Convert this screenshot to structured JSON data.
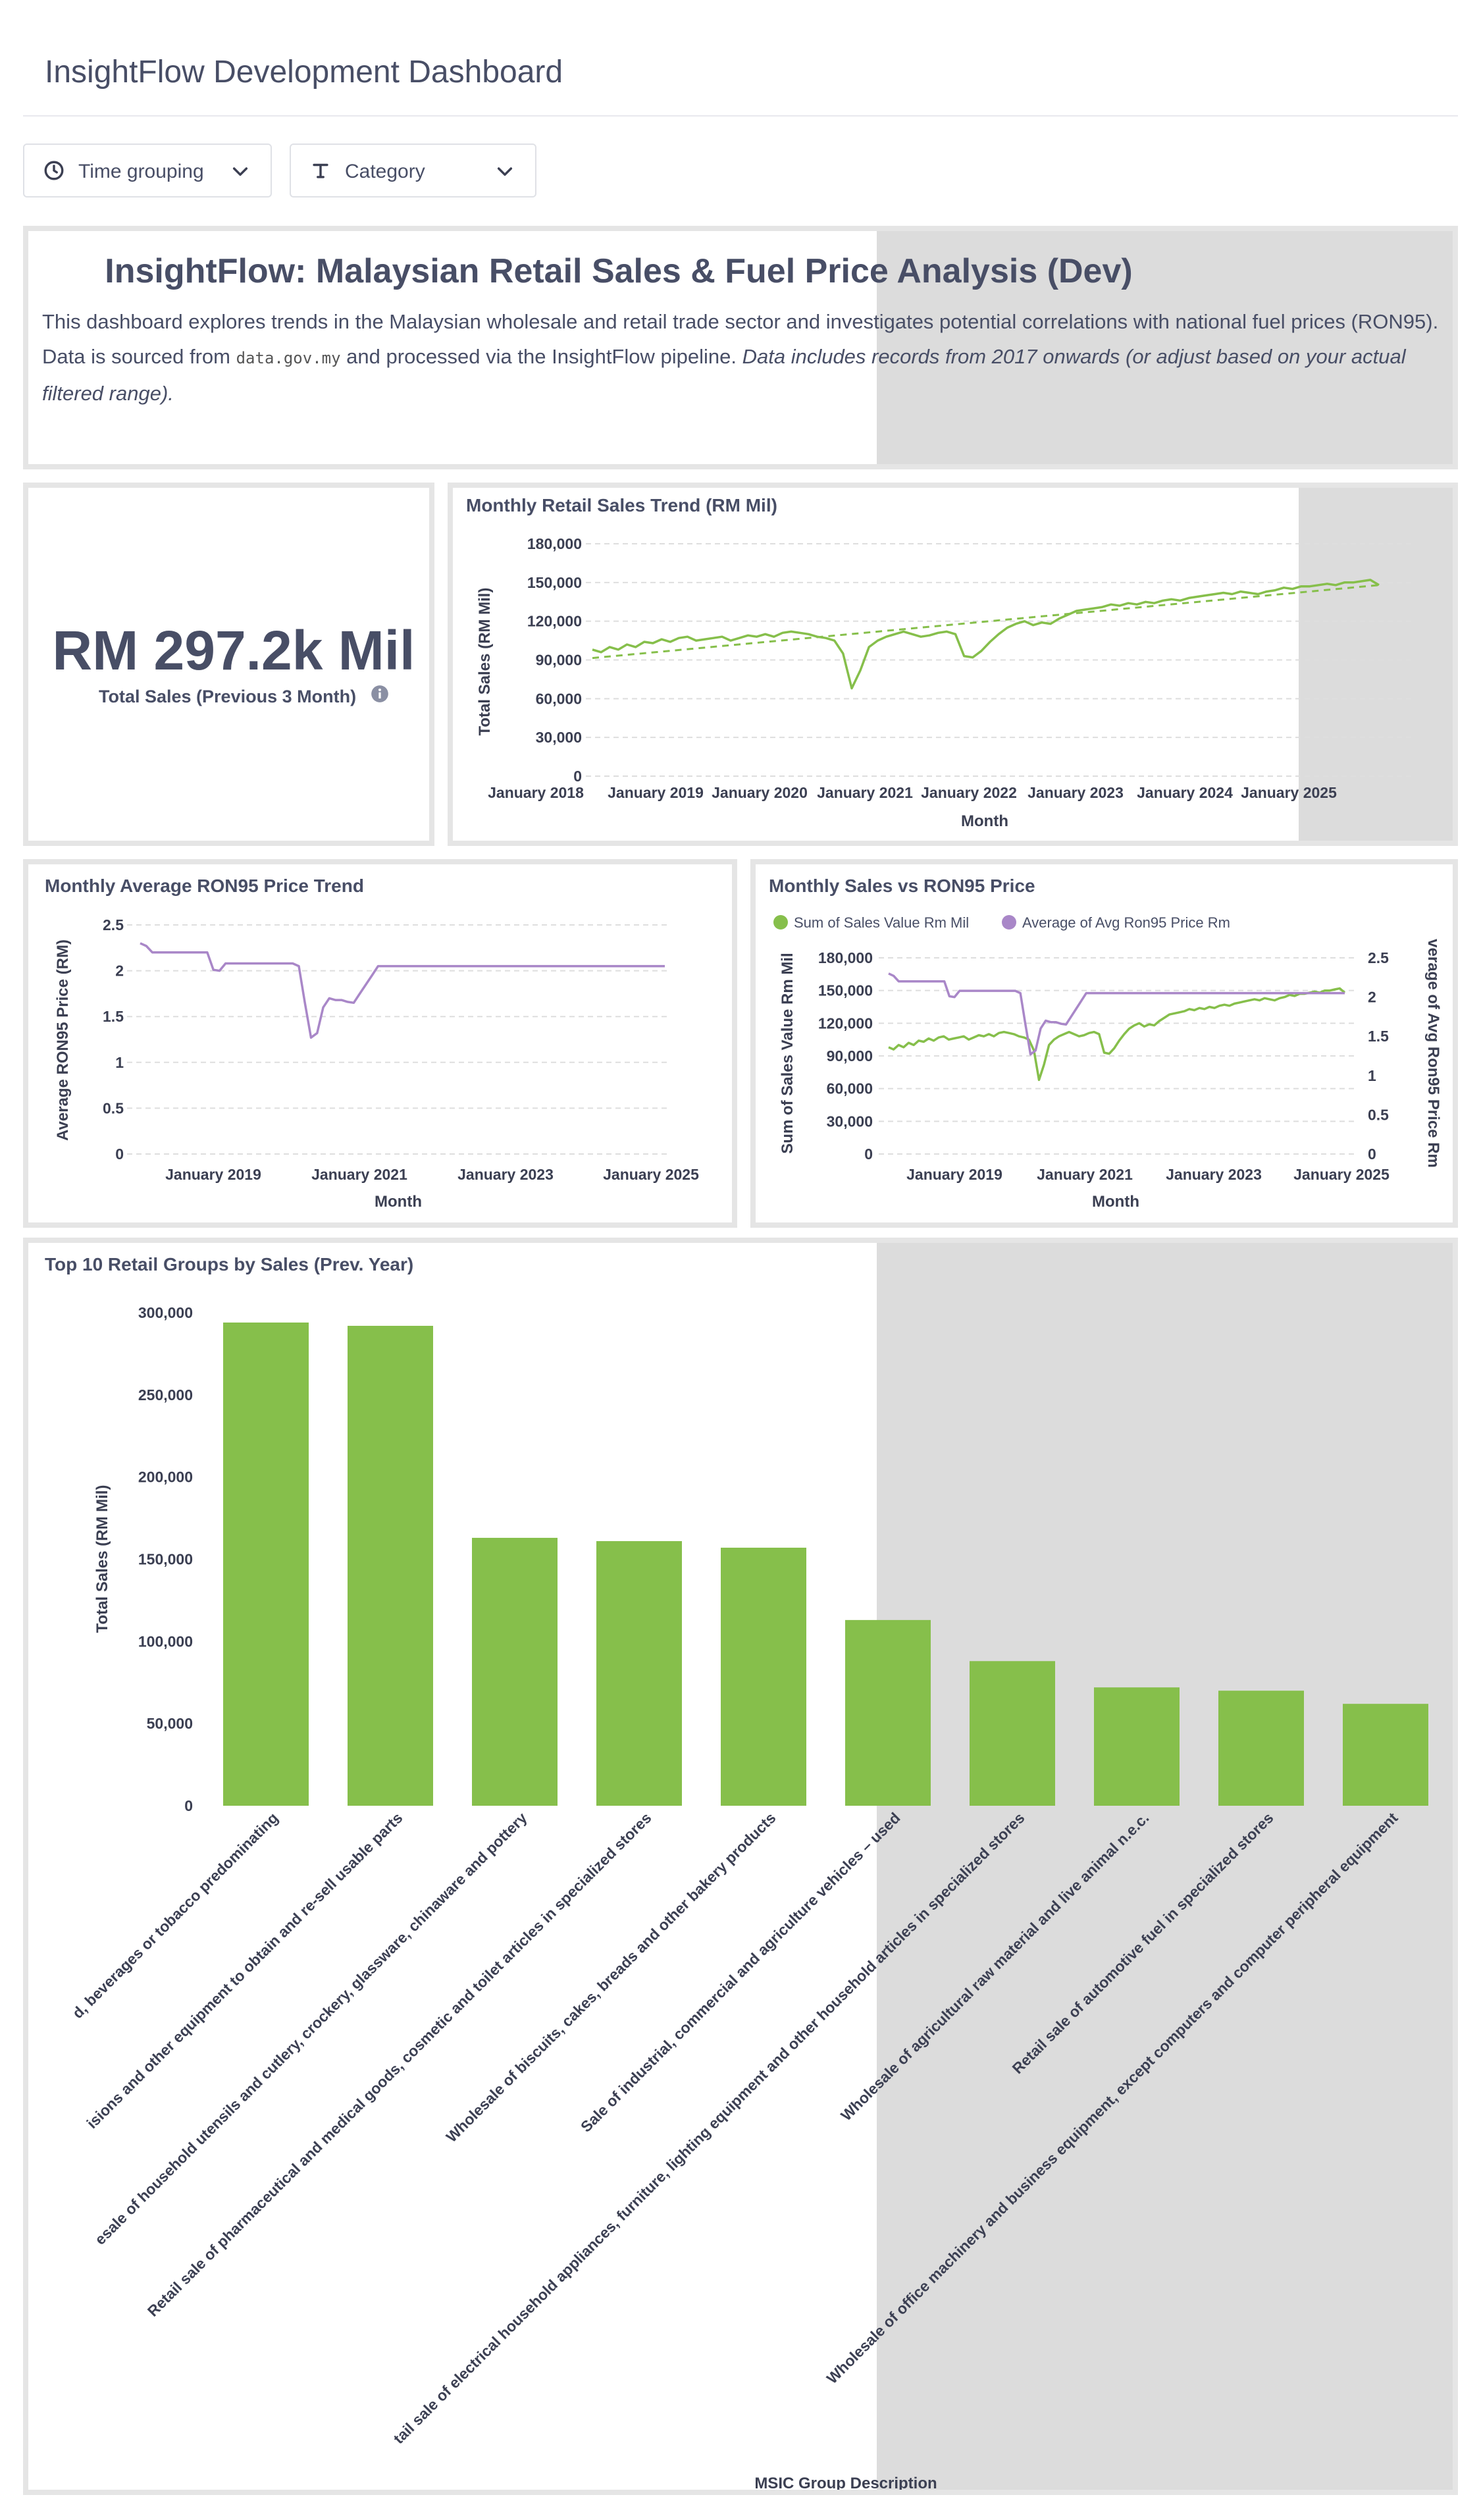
{
  "header": {
    "title": "InsightFlow Development Dashboard"
  },
  "filters": [
    {
      "label": "Time grouping",
      "icon": "clock-icon"
    },
    {
      "label": "Category",
      "icon": "text-type-icon"
    }
  ],
  "intro": {
    "heading": "InsightFlow: Malaysian Retail Sales & Fuel Price Analysis (Dev)",
    "body_1": "This dashboard explores trends in the Malaysian wholesale and retail trade sector and investigates potential correlations with national fuel prices (RON95). Data is sourced from ",
    "code": "data.gov.my",
    "body_2": " and processed via the InsightFlow pipeline. ",
    "body_italic": "Data includes records from 2017 onwards (or adjust based on your actual filtered range)."
  },
  "kpi": {
    "value": "RM 297.2k Mil",
    "label": "Total Sales (Previous 3 Month)",
    "icon": "info-icon"
  },
  "colors": {
    "green": "#86bf4b",
    "purple": "#a987c8",
    "shade": "#dcdcdc",
    "text": "#484e66"
  },
  "chart_data": [
    {
      "type": "line",
      "title": "Monthly Retail Sales Trend (RM Mil)",
      "xlabel": "Month",
      "ylabel": "Total Sales (RM Mil)",
      "ylim": [
        0,
        180000
      ],
      "yticks": [
        "0",
        "30,000",
        "60,000",
        "90,000",
        "120,000",
        "150,000",
        "180,000"
      ],
      "xticks": [
        "January 2018",
        "January 2019",
        "January 2020",
        "January 2021",
        "January 2022",
        "January 2023",
        "January 2024",
        "January 2025"
      ],
      "trendline": true,
      "series": [
        {
          "values": [
            98000,
            96000,
            100000,
            98000,
            102000,
            100000,
            104000,
            103000,
            106000,
            104000,
            107000,
            108000,
            105000,
            106000,
            107000,
            108000,
            105000,
            107000,
            109000,
            108000,
            110000,
            108000,
            111000,
            112000,
            111000,
            110000,
            108000,
            107000,
            105000,
            95000,
            68000,
            82000,
            100000,
            105000,
            108000,
            110000,
            112000,
            110000,
            108000,
            109000,
            111000,
            112000,
            110000,
            93000,
            92000,
            97000,
            104000,
            110000,
            115000,
            118000,
            120000,
            117000,
            119000,
            118000,
            122000,
            125000,
            128000,
            129000,
            130000,
            131000,
            133000,
            132000,
            134000,
            133000,
            135000,
            134000,
            136000,
            137000,
            136000,
            138000,
            139000,
            140000,
            141000,
            142000,
            141000,
            143000,
            142000,
            141000,
            143000,
            144000,
            146000,
            145000,
            147000,
            147000,
            148000,
            149000,
            148000,
            150000,
            150000,
            151000,
            152000,
            148000
          ]
        }
      ]
    },
    {
      "type": "line",
      "title": "Monthly Average RON95 Price Trend",
      "xlabel": "Month",
      "ylabel": "Average RON95 Price (RM)",
      "ylim": [
        0,
        2.5
      ],
      "yticks": [
        "0",
        "0.5",
        "1",
        "1.5",
        "2",
        "2.5"
      ],
      "xticks": [
        "January 2019",
        "January 2021",
        "January 2023",
        "January 2025"
      ],
      "series": [
        {
          "values": [
            2.3,
            2.27,
            2.2,
            2.2,
            2.2,
            2.2,
            2.2,
            2.2,
            2.2,
            2.2,
            2.2,
            2.2,
            2.01,
            2.0,
            2.08,
            2.08,
            2.08,
            2.08,
            2.08,
            2.08,
            2.08,
            2.08,
            2.08,
            2.08,
            2.08,
            2.08,
            2.05,
            1.65,
            1.27,
            1.32,
            1.6,
            1.7,
            1.68,
            1.68,
            1.66,
            1.65,
            1.75,
            1.85,
            1.95,
            2.05,
            2.05,
            2.05,
            2.05,
            2.05,
            2.05,
            2.05,
            2.05,
            2.05,
            2.05,
            2.05,
            2.05,
            2.05,
            2.05,
            2.05,
            2.05,
            2.05,
            2.05,
            2.05,
            2.05,
            2.05,
            2.05,
            2.05,
            2.05,
            2.05,
            2.05,
            2.05,
            2.05,
            2.05,
            2.05,
            2.05,
            2.05,
            2.05,
            2.05,
            2.05,
            2.05,
            2.05,
            2.05,
            2.05,
            2.05,
            2.05,
            2.05,
            2.05,
            2.05,
            2.05,
            2.05,
            2.05,
            2.05
          ]
        }
      ]
    },
    {
      "type": "line",
      "title": "Monthly Sales vs RON95 Price",
      "xlabel": "Month",
      "ylabel": "Sum of Sales Value Rm Mil",
      "y2label": "verage of Avg Ron95 Price Rm",
      "ylim": [
        0,
        180000
      ],
      "y2lim": [
        0,
        2.5
      ],
      "yticks": [
        "0",
        "30,000",
        "60,000",
        "90,000",
        "120,000",
        "150,000",
        "180,000"
      ],
      "y2ticks": [
        "0",
        "0.5",
        "1",
        "1.5",
        "2",
        "2.5"
      ],
      "xticks": [
        "January 2019",
        "January 2021",
        "January 2023",
        "January 2025"
      ],
      "legend": "top-left",
      "series": [
        {
          "name": "Sum of Sales Value Rm Mil",
          "axis": "left",
          "values": [
            98000,
            96000,
            100000,
            98000,
            102000,
            100000,
            104000,
            103000,
            106000,
            104000,
            107000,
            108000,
            105000,
            106000,
            107000,
            108000,
            105000,
            107000,
            109000,
            108000,
            110000,
            108000,
            111000,
            112000,
            111000,
            110000,
            108000,
            107000,
            105000,
            95000,
            68000,
            82000,
            100000,
            105000,
            108000,
            110000,
            112000,
            110000,
            108000,
            109000,
            111000,
            112000,
            110000,
            93000,
            92000,
            97000,
            104000,
            110000,
            115000,
            118000,
            120000,
            117000,
            119000,
            118000,
            122000,
            125000,
            128000,
            129000,
            130000,
            131000,
            133000,
            132000,
            134000,
            133000,
            135000,
            134000,
            136000,
            137000,
            136000,
            138000,
            139000,
            140000,
            141000,
            142000,
            141000,
            143000,
            142000,
            141000,
            143000,
            144000,
            146000,
            145000,
            147000,
            147000,
            148000,
            149000,
            148000,
            150000,
            150000,
            151000,
            152000,
            148000
          ]
        },
        {
          "name": "Average of Avg Ron95 Price Rm",
          "axis": "right",
          "values": [
            2.3,
            2.27,
            2.2,
            2.2,
            2.2,
            2.2,
            2.2,
            2.2,
            2.2,
            2.2,
            2.2,
            2.2,
            2.01,
            2.0,
            2.08,
            2.08,
            2.08,
            2.08,
            2.08,
            2.08,
            2.08,
            2.08,
            2.08,
            2.08,
            2.08,
            2.08,
            2.05,
            1.65,
            1.27,
            1.32,
            1.6,
            1.7,
            1.68,
            1.68,
            1.66,
            1.65,
            1.75,
            1.85,
            1.95,
            2.05,
            2.05,
            2.05,
            2.05,
            2.05,
            2.05,
            2.05,
            2.05,
            2.05,
            2.05,
            2.05,
            2.05,
            2.05,
            2.05,
            2.05,
            2.05,
            2.05,
            2.05,
            2.05,
            2.05,
            2.05,
            2.05,
            2.05,
            2.05,
            2.05,
            2.05,
            2.05,
            2.05,
            2.05,
            2.05,
            2.05,
            2.05,
            2.05,
            2.05,
            2.05,
            2.05,
            2.05,
            2.05,
            2.05,
            2.05,
            2.05,
            2.05,
            2.05,
            2.05,
            2.05,
            2.05,
            2.05,
            2.05,
            2.05,
            2.05,
            2.05,
            2.05
          ]
        }
      ]
    },
    {
      "type": "bar",
      "title": "Top 10 Retail Groups by Sales (Prev. Year)",
      "xlabel": "MSIC  Group Description",
      "ylabel": "Total Sales (RM Mil)",
      "ylim": [
        0,
        300000
      ],
      "yticks": [
        "0",
        "50,000",
        "100,000",
        "150,000",
        "200,000",
        "250,000",
        "300,000"
      ],
      "categories": [
        "d, beverages or tobacco predominating",
        "isions and other equipment to obtain and re-sell usable parts",
        "esale of household utensils and cutlery, crockery, glassware, chinaware and pottery",
        "Retail sale of pharmaceutical and medical goods, cosmetic and toilet articles in specialized stores",
        "Wholesale of biscuits, cakes, breads and other bakery products",
        "Sale of industrial, commercial and agriculture vehicles – used",
        "tail sale of electrical household appliances, furniture, lighting equipment and other household articles in specialized stores",
        "Wholesale of agricultural raw material and live animal n.e.c.",
        "Retail sale of automotive fuel in specialized stores",
        "Wholesale of office machinery and business equipment, except computers and computer peripheral equipment"
      ],
      "values": [
        294000,
        292000,
        163000,
        161000,
        157000,
        113000,
        88000,
        72000,
        70000,
        62000
      ]
    }
  ]
}
